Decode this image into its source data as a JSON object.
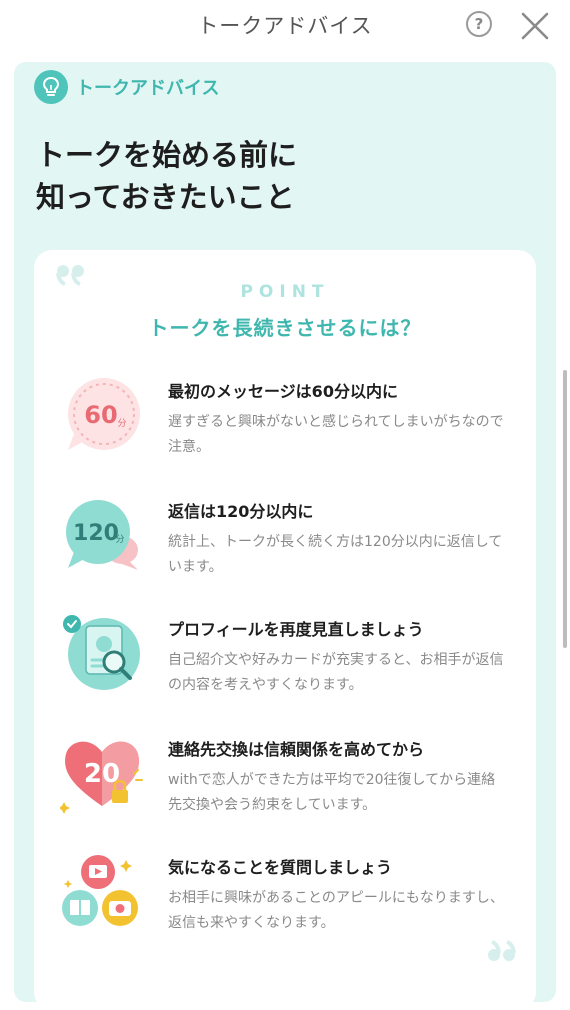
{
  "header": {
    "title": "トークアドバイス"
  },
  "panel": {
    "tag_label": "トークアドバイス",
    "headline_line1": "トークを始める前に",
    "headline_line2": "知っておきたいこと"
  },
  "card": {
    "point_label": "POINT",
    "title": "トークを長続きさせるには？",
    "tips": [
      {
        "title": "最初のメッセージは60分以内に",
        "desc": "遅すぎると興味がないと感じられてしまいがちなので注意。",
        "badge": "60"
      },
      {
        "title": "返信は120分以内に",
        "desc": "統計上、トークが長く続く方は120分以内に返信しています。",
        "badge": "120"
      },
      {
        "title": "プロフィールを再度見直しましょう",
        "desc": "自己紹介文や好みカードが充実すると、お相手が返信の内容を考えやすくなります。"
      },
      {
        "title": "連絡先交換は信頼関係を高めてから",
        "desc": "withで恋人ができた方は平均で20往復してから連絡先交換や会う約束をしています。",
        "badge": "20"
      },
      {
        "title": "気になることを質問しましょう",
        "desc": "お相手に興味があることのアピールにもなりますし、返信も来やすくなります。"
      }
    ]
  },
  "colors": {
    "accent": "#3fb7ae",
    "panel_bg": "#e2f6f4",
    "pink": "#f1a3a8",
    "mint": "#8fdcd3"
  },
  "icons": [
    "help-icon",
    "close-icon",
    "bulb-icon",
    "quote-icon",
    "clock-bubble-icon",
    "chat-bubble-icon",
    "profile-search-icon",
    "heart-lock-icon",
    "interests-icon"
  ]
}
